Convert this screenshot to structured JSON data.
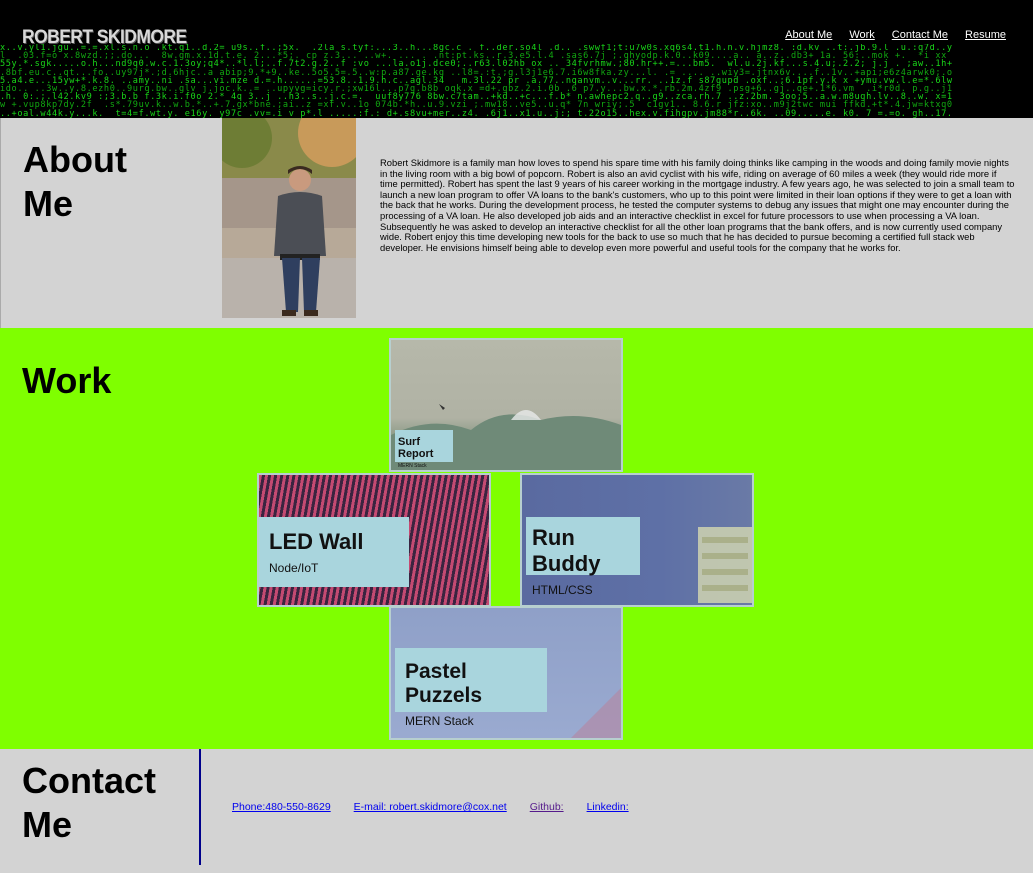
{
  "header": {
    "logo": "ROBERT SKIDMORE",
    "nav": [
      "About Me",
      "Work",
      "Contact Me",
      "Resume"
    ]
  },
  "about": {
    "title": "About Me",
    "text": "Robert Skidmore is a family man how loves to spend his spare time with his family doing thinks like camping in the woods and doing family movie nights in the living room with a big bowl of popcorn. Robert is also an avid cyclist with his wife, riding on average of 60 miles a week (they would ride more if time permitted). Robert has spent the last 9 years of his career working in the mortgage industry. A few years ago, he was selected to join a small team to launch a new loan program to offer VA loans to the bank's customers, who up to this point were limited in their loan options if they were to get a loan with the back that he works. During the development process, he tested the computer systems to debug any issues that might one may encounter during the processing of a VA loan. He also developed job aids and an interactive checklist in excel for future processors to use when processing a VA loan. Subsequently he was asked to develop an interactive checklist for all the other loan programs that the bank offers, and is now currently used company wide. Robert enjoy this time developing new tools for the back to use so much that he has decided to pursue becoming a certified full stack web developer. He envisions himself being able to develop even more powerful and useful tools for the company that he works for."
  },
  "work": {
    "title": "Work",
    "projects": [
      {
        "title": "Surf Report",
        "sub": "MERN Stack"
      },
      {
        "title": "LED Wall",
        "sub": "Node/IoT"
      },
      {
        "title": "Run Buddy",
        "sub": "HTML/CSS"
      },
      {
        "title": "Pastel Puzzels",
        "sub": "MERN Stack"
      }
    ]
  },
  "contact": {
    "title": "Contact Me",
    "links": [
      "Phone:480-550-8629",
      "E-mail: robert.skidmore@cox.net",
      "Github:",
      "Linkedin:"
    ]
  },
  "colors": {
    "header_bg": "#000000",
    "matrix_green": "#19d619",
    "work_bg": "#7fff00",
    "section_bg": "#d3d3d3",
    "divider": "#00008b"
  }
}
